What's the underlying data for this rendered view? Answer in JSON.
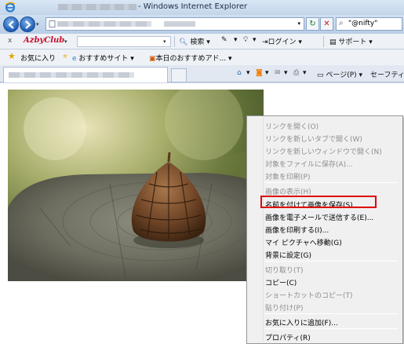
{
  "window": {
    "title": "- Windows Internet Explorer"
  },
  "address": {
    "dropdown_glyph": "▾",
    "refresh_glyph": "↻",
    "stop_glyph": "✕"
  },
  "search": {
    "query": "\"@nifty\""
  },
  "toolbar": {
    "close": "x",
    "brand": "AzbyClub",
    "search_label": "検索",
    "login_label": "ログイン",
    "support_label": "サポート"
  },
  "favorites": {
    "favorites_label": "お気に入り",
    "recommended_sites": "おすすめサイト",
    "todays_pick": "本日のおすすめアド..."
  },
  "commandbar": {
    "page_label": "ページ(P)",
    "safety_label": "セーフティ"
  },
  "context_menu": {
    "items": [
      {
        "label": "リンクを開く(O)",
        "disabled": true
      },
      {
        "label": "リンクを新しいタブで開く(W)",
        "disabled": true
      },
      {
        "label": "リンクを新しいウィンドウで開く(N)",
        "disabled": true
      },
      {
        "label": "対象をファイルに保存(A)...",
        "disabled": true
      },
      {
        "label": "対象を印刷(P)",
        "disabled": true
      },
      {
        "label": "画像の表示(H)",
        "disabled": true
      },
      {
        "label": "名前を付けて画像を保存(S)...",
        "disabled": false,
        "highlighted": true
      },
      {
        "label": "画像を電子メールで送信する(E)...",
        "disabled": false
      },
      {
        "label": "画像を印刷する(I)...",
        "disabled": false
      },
      {
        "label": "マイ ピクチャへ移動(G)",
        "disabled": false
      },
      {
        "label": "背景に設定(G)",
        "disabled": false
      },
      {
        "label": "切り取り(T)",
        "disabled": true
      },
      {
        "label": "コピー(C)",
        "disabled": false
      },
      {
        "label": "ショートカットのコピー(T)",
        "disabled": true
      },
      {
        "label": "貼り付け(P)",
        "disabled": true
      },
      {
        "label": "お気に入りに追加(F)...",
        "disabled": false
      },
      {
        "label": "プロパティ(R)",
        "disabled": false
      }
    ]
  },
  "colors": {
    "highlight_border": "#e00000",
    "disabled_text": "#8d8d8d",
    "brand": "#c8102e"
  }
}
